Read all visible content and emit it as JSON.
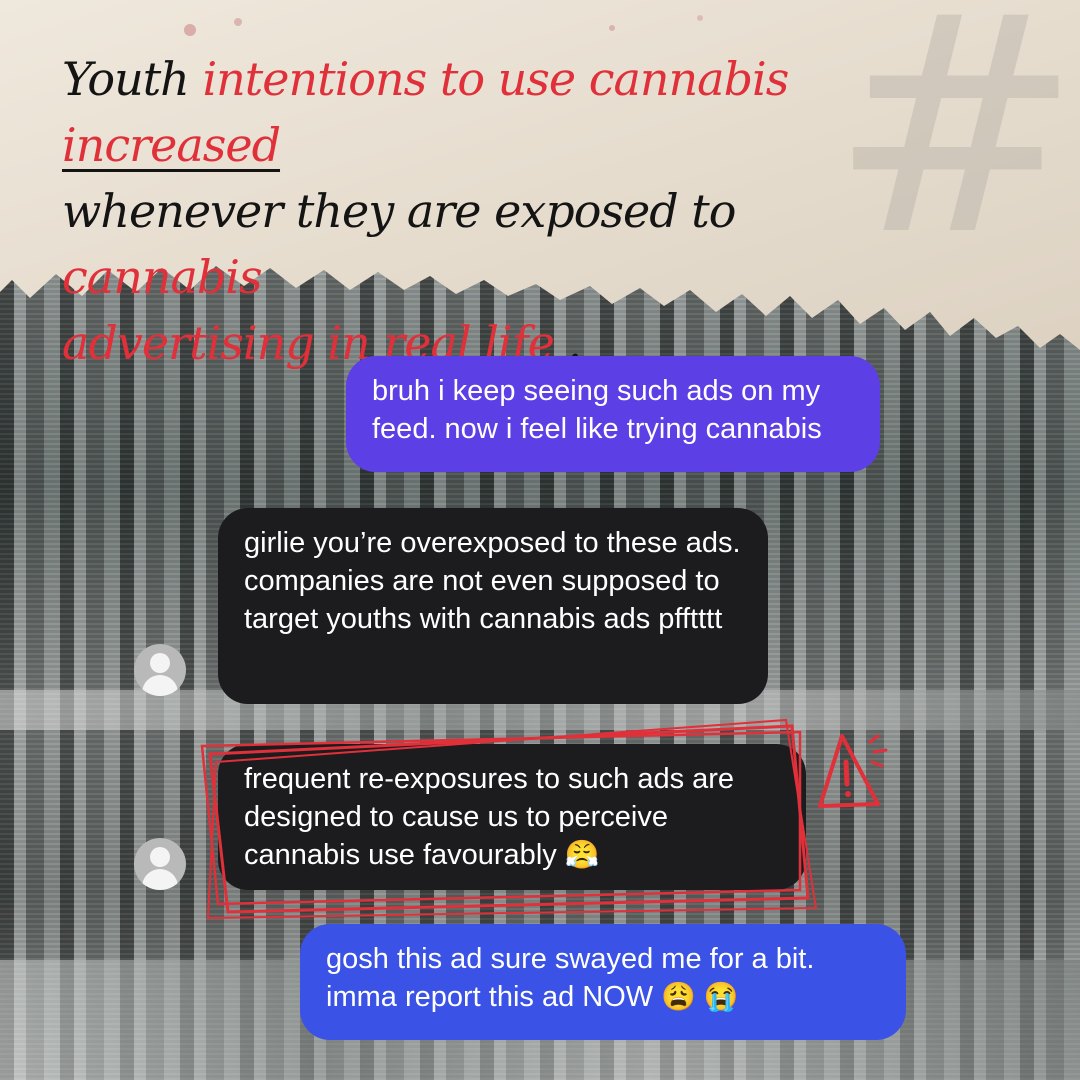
{
  "header": {
    "line1_a": "Youth ",
    "line1_b": "intentions to use cannabis ",
    "line1_c": "increased",
    "line2_a": "whenever they are exposed to ",
    "line2_b": "cannabis",
    "line3_a": "advertising in real life",
    "line3_b": " ."
  },
  "chat": {
    "sent_1": "bruh i keep seeing such ads on my feed. now i feel like trying cannabis",
    "recv_1": "girlie you’re overexposed to these ads. companies are not even supposed to target youths with cannabis ads pfftttt",
    "recv_2": "frequent re-exposures to such ads are designed to cause us to perceive cannabis use favourably",
    "recv_2_emoji": "😤",
    "sent_2": "gosh this ad sure swayed me for a bit. imma report this ad NOW",
    "sent_2_emoji": "😩 😭"
  },
  "colors": {
    "sent_bubble_1": "#5c40e6",
    "sent_bubble_2": "#3a52e6",
    "recv_bubble": "#1c1c1e",
    "accent_red": "#e0303a",
    "paper": "#e9e2d6"
  },
  "icons": [
    "avatar-placeholder-icon",
    "warning-icon"
  ]
}
